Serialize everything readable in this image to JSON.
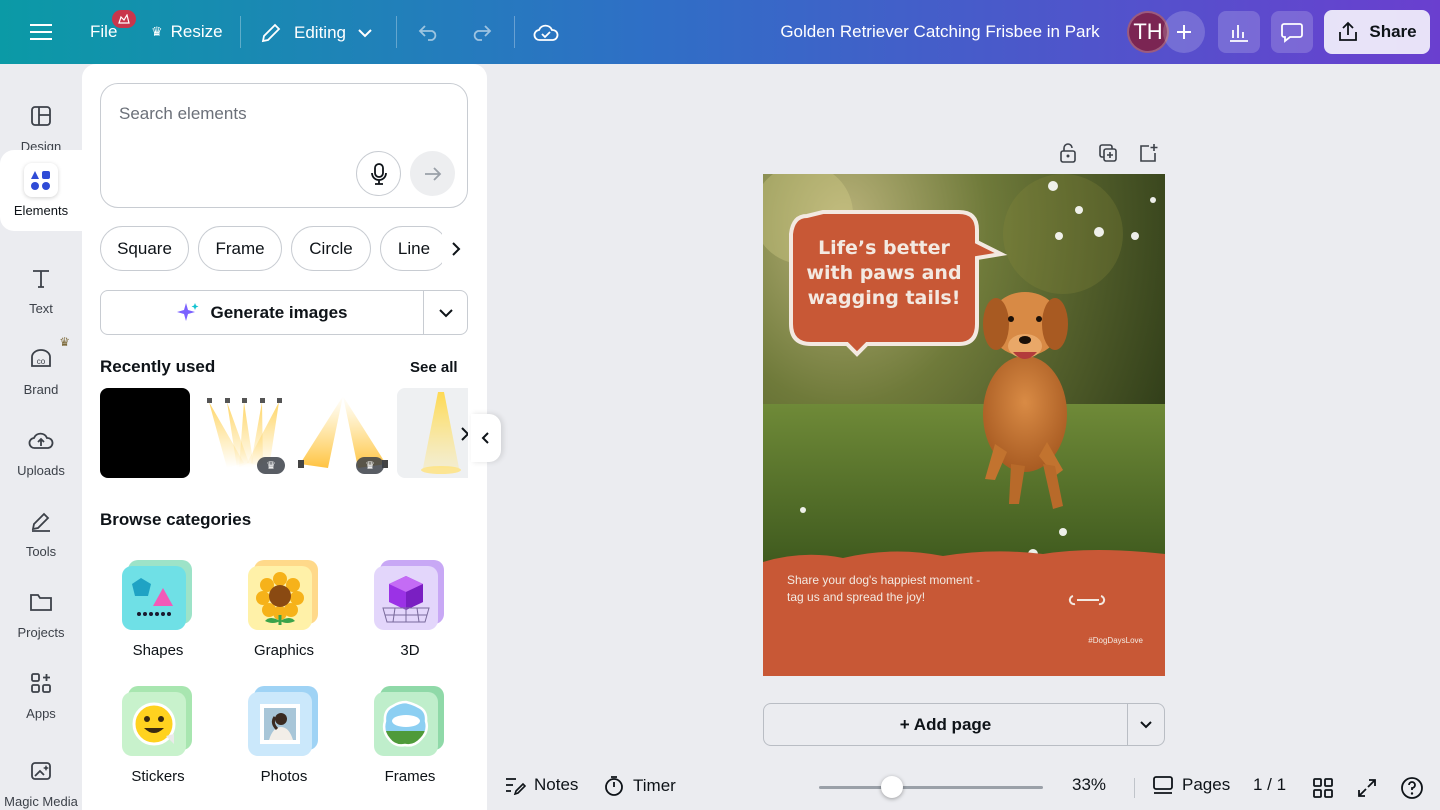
{
  "topbar": {
    "file_label": "File",
    "resize_label": "Resize",
    "editing_label": "Editing",
    "document_title": "Golden Retriever Catching Frisbee in Park",
    "avatar_initials": "TH",
    "share_label": "Share",
    "accent_colors": {
      "gradient_start": "#0b9aa6",
      "gradient_end": "#6a3fcf",
      "avatar_bg": "#7b2553"
    }
  },
  "rail": {
    "items": [
      {
        "label": "Design",
        "icon": "layout-icon"
      },
      {
        "label": "Elements",
        "icon": "shapes-icon"
      },
      {
        "label": "Text",
        "icon": "text-icon"
      },
      {
        "label": "Brand",
        "icon": "brand-icon"
      },
      {
        "label": "Uploads",
        "icon": "cloud-upload-icon"
      },
      {
        "label": "Tools",
        "icon": "pen-icon"
      },
      {
        "label": "Projects",
        "icon": "folder-icon"
      },
      {
        "label": "Apps",
        "icon": "apps-icon"
      },
      {
        "label": "Magic Media",
        "icon": "magic-media-icon"
      }
    ],
    "active": "Elements"
  },
  "panel": {
    "search_placeholder": "Search elements",
    "chips": [
      "Square",
      "Frame",
      "Circle",
      "Line"
    ],
    "generate_label": "Generate images",
    "recently_used_title": "Recently used",
    "see_all_label": "See all",
    "browse_title": "Browse categories",
    "categories": [
      {
        "label": "Shapes"
      },
      {
        "label": "Graphics"
      },
      {
        "label": "3D"
      },
      {
        "label": "Stickers"
      },
      {
        "label": "Photos"
      },
      {
        "label": "Frames"
      }
    ]
  },
  "design": {
    "bubble_text": "Life’s better with paws and wagging tails!",
    "caption_text": "Share your dog's happiest moment - tag us and spread the joy!",
    "hashtag": "#DogDaysLove",
    "brand_color": "#c85836"
  },
  "canvas": {
    "add_page_label": "+ Add page"
  },
  "bottombar": {
    "notes_label": "Notes",
    "timer_label": "Timer",
    "zoom_level": "33%",
    "zoom_fraction": 0.3,
    "pages_label": "Pages",
    "page_count": "1 / 1"
  }
}
